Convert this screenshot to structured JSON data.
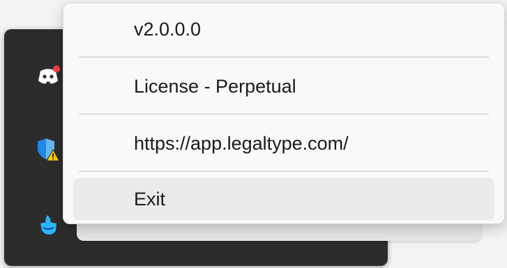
{
  "tray": {
    "icons": [
      {
        "name": "discord-icon",
        "color": "#ffffff",
        "badge_color": "#f23f43"
      },
      {
        "name": "windows-security-warning-icon",
        "color": "#1e90ff",
        "badge_color": "#ffcc00"
      },
      {
        "name": "legaltype-icon",
        "color": "#29b6f6"
      }
    ]
  },
  "menu": {
    "items": [
      {
        "label": "v2.0.0.0"
      },
      {
        "label": "License - Perpetual"
      },
      {
        "label": "https://app.legaltype.com/"
      },
      {
        "label": "Exit"
      }
    ]
  }
}
